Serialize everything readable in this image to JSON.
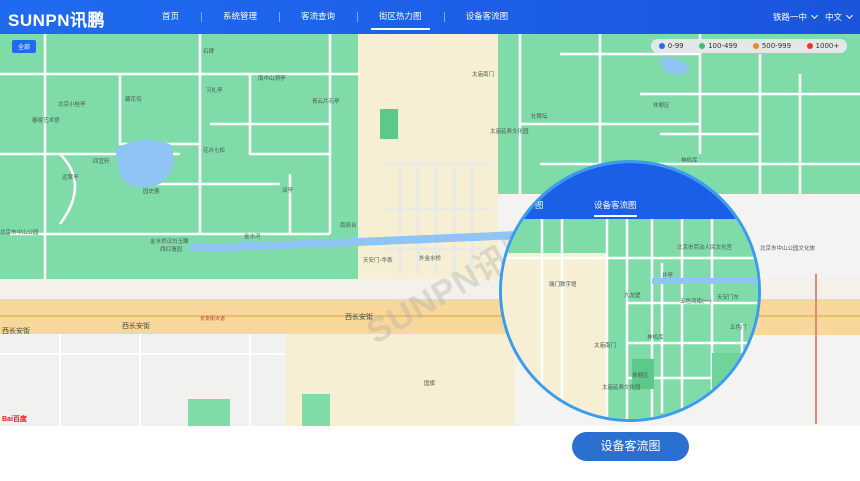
{
  "header": {
    "logo": "SUNPN讯鹏",
    "nav": [
      {
        "label": "首页",
        "active": false
      },
      {
        "label": "系统管理",
        "active": false
      },
      {
        "label": "客流查询",
        "active": false
      },
      {
        "label": "街区热力图",
        "active": true
      },
      {
        "label": "设备客流图",
        "active": false
      }
    ],
    "location": "铁路一中",
    "language": "中文"
  },
  "map": {
    "area_tag": "全部",
    "legend": [
      {
        "label": "0-99",
        "color": "#2a6fe0"
      },
      {
        "label": "100-499",
        "color": "#3cc36a"
      },
      {
        "label": "500-999",
        "color": "#e88a2c"
      },
      {
        "label": "1000+",
        "color": "#e23a2a"
      }
    ],
    "poi_labels": [
      "石碑",
      "南中山洞亭",
      "习礼亭",
      "青云片石亭",
      "北京小桂亭",
      "藏花坞",
      "春晓艺术馆",
      "花卉七松",
      "四宜轩",
      "远翠亭",
      "园史展",
      "双亭",
      "南辰台",
      "北京市中山公园",
      "金水桥汉白玉雕",
      "西红墙园",
      "金水河",
      "天安门-华表",
      "外金水桥",
      "国旗",
      "太庙南门",
      "休憩区",
      "太庙延寿文化园",
      "神机库",
      "社稷坛",
      "北京市中山公园文化旅"
    ],
    "streets": [
      "西长安街",
      "西长安街",
      "西长安街",
      "长安街大道"
    ],
    "watermark": "SUNPN讯鹏",
    "map_brand": "Bai百度"
  },
  "magnifier": {
    "tabs": [
      {
        "label": "图",
        "active": false
      },
      {
        "label": "设备客流图",
        "active": true
      }
    ],
    "labels": [
      "北京市劳动人民文化宫",
      "井亭",
      "端门数字馆",
      "九龙壁",
      "五色流南(一)",
      "神机库",
      "五色门",
      "太庙南门",
      "天安门东",
      "休憩区",
      "太庙延寿文化园"
    ]
  },
  "caption": "设备客流图",
  "colors": {
    "brand": "#1f6bf0",
    "park": "#7fdca8",
    "road": "#f7d89a",
    "water": "#8fc4f4",
    "plaza": "#f6efd4"
  }
}
